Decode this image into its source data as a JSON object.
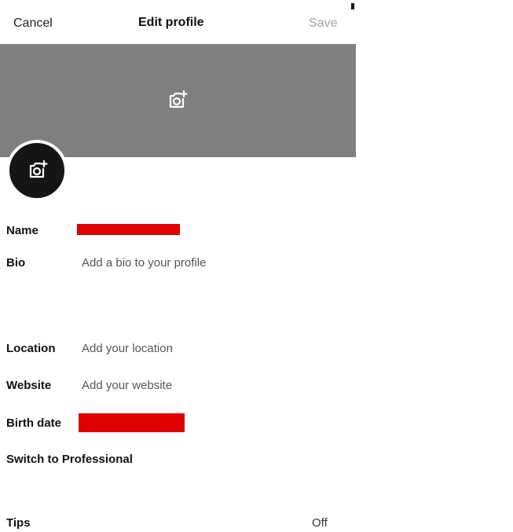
{
  "header": {
    "cancel_label": "Cancel",
    "title": "Edit profile",
    "save_label": "Save"
  },
  "colors": {
    "banner": "#808080",
    "avatar": "#151515",
    "redaction": "#e00000",
    "save_disabled": "#a3a3a3"
  },
  "icons": {
    "banner_camera": "camera-plus-icon",
    "avatar_camera": "camera-plus-icon"
  },
  "fields": {
    "name_label": "Name",
    "bio_label": "Bio",
    "bio_placeholder": "Add a bio to your profile",
    "location_label": "Location",
    "location_placeholder": "Add your location",
    "website_label": "Website",
    "website_placeholder": "Add your website",
    "birth_date_label": "Birth date"
  },
  "switch_professional_label": "Switch to Professional",
  "tips": {
    "label": "Tips",
    "value": "Off"
  }
}
